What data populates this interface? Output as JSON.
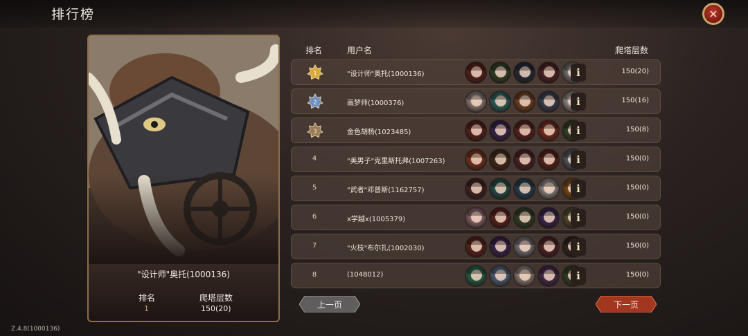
{
  "header": {
    "title": "排行榜"
  },
  "version": "Z.4.8(1000136)",
  "portrait": {
    "name": "\"设计师\"奥托(1000136)",
    "rank_label": "排名",
    "rank_value": "1",
    "floor_label": "爬塔层数",
    "floor_value": "150(20)"
  },
  "table": {
    "col_rank": "排名",
    "col_user": "用户名",
    "col_floors": "爬塔层数",
    "rows": [
      {
        "rank": "1",
        "medal": "gold",
        "name": "\"设计师\"奥托(1000136)",
        "floors": "150(20)",
        "avatars": [
          "#7a2b26",
          "#3f5b35",
          "#2b3a4e",
          "#6b2a35",
          "#a7a6b2"
        ]
      },
      {
        "rank": "2",
        "medal": "silver",
        "name": "画梦师(1000376)",
        "floors": "150(16)",
        "avatars": [
          "#c8b7b0",
          "#3a8f8a",
          "#a35c2c",
          "#4b5c7a",
          "#d3d2d6"
        ]
      },
      {
        "rank": "3",
        "medal": "bronze",
        "name": "金色胡杨(1023485)",
        "floors": "150(8)",
        "avatars": [
          "#7a2b26",
          "#4a2e6e",
          "#7d2a2a",
          "#a83a2a",
          "#3f5b35"
        ]
      },
      {
        "rank": "4",
        "medal": "",
        "name": "\"美男子\"克里斯托弗(1007263)",
        "floors": "150(0)",
        "avatars": [
          "#a8452a",
          "#5a3a22",
          "#6b2a35",
          "#7a2b26",
          "#6f7f97"
        ]
      },
      {
        "rank": "5",
        "medal": "",
        "name": "\"武者\"邓普斯(1162757)",
        "floors": "150(0)",
        "avatars": [
          "#5a2a2e",
          "#2f6f6a",
          "#2b5c7a",
          "#c7c3c8",
          "#b06a1e"
        ]
      },
      {
        "rank": "6",
        "medal": "",
        "name": "x学越x(1005379)",
        "floors": "150(0)",
        "avatars": [
          "#c890a0",
          "#7a2b26",
          "#3f5b35",
          "#4a2e6e",
          "#6b6a3a"
        ]
      },
      {
        "rank": "7",
        "medal": "",
        "name": "\"火枝\"布尔扎(1002030)",
        "floors": "150(0)",
        "avatars": [
          "#7a2b26",
          "#4a2e6e",
          "#a7a6b2",
          "#6b2a35",
          "#3a2b2b"
        ]
      },
      {
        "rank": "8",
        "medal": "",
        "name": "(1048012)",
        "floors": "150(0)",
        "avatars": [
          "#2f8a6a",
          "#6f8fb5",
          "#c8b7b0",
          "#5a3a6e",
          "#3f5b35"
        ]
      }
    ]
  },
  "pager": {
    "prev": "上一页",
    "next": "下一页"
  },
  "colors": {
    "gold": "#d9a93a",
    "silver": "#6f8fc2",
    "bronze": "#9a7a52",
    "accent_red": "#c0392b"
  },
  "icons": {
    "close": "close-icon",
    "info": "info-icon"
  }
}
